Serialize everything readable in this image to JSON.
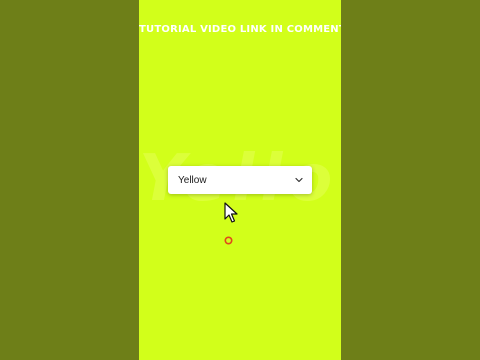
{
  "banner": {
    "text": "TUTORIAL VIDEO LINK IN COMMENTS"
  },
  "background_word": {
    "text": "Yellow"
  },
  "dropdown": {
    "selected_value": "Yellow"
  },
  "icons": {
    "dropdown_indicator": "chevron-down-icon",
    "pointer": "mouse-cursor-icon",
    "click_marker": "click-ring-icon"
  },
  "colors": {
    "outer_background": "#6e7f18",
    "stage_background": "#d2ff1a",
    "ghost_text": "#dcff3a",
    "click_ring": "#e0491a"
  }
}
